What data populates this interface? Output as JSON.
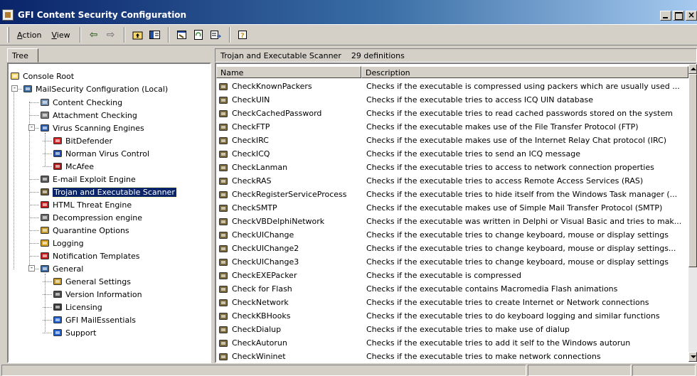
{
  "window": {
    "title": "GFI Content Security Configuration",
    "close_glyph": "×"
  },
  "menu": {
    "action_first": "A",
    "action_rest": "ction",
    "view_first": "V",
    "view_rest": "iew"
  },
  "toolbar_icons": [
    "back-arrow-icon",
    "forward-arrow-icon",
    "up-folder-icon",
    "show-tree-icon",
    "properties-icon",
    "refresh-icon",
    "export-list-icon",
    "help-icon"
  ],
  "toolbar_glyphs": {
    "back": "⇦",
    "forward": "⇨"
  },
  "left_tab": {
    "label": "Tree"
  },
  "tree": [
    {
      "label": "Console Root",
      "icon": "folder-icon",
      "color": "#f5d76e"
    },
    {
      "label": "MailSecurity Configuration (Local)",
      "icon": "mailsecurity-icon",
      "color": "#3a6ea5"
    },
    {
      "label": "Content Checking",
      "icon": "content-checking-icon",
      "color": "#6f8fb3"
    },
    {
      "label": "Attachment Checking",
      "icon": "paperclip-icon",
      "color": "#808080"
    },
    {
      "label": "Virus Scanning Engines",
      "icon": "virus-engines-icon",
      "color": "#2f5fb3"
    },
    {
      "label": "BitDefender",
      "icon": "bitdefender-icon",
      "color": "#d42020"
    },
    {
      "label": "Norman Virus Control",
      "icon": "norman-icon",
      "color": "#1f4fa8"
    },
    {
      "label": "McAfee",
      "icon": "mcafee-icon",
      "color": "#b01818"
    },
    {
      "label": "E-mail Exploit Engine",
      "icon": "exploit-engine-icon",
      "color": "#5a5a5a"
    },
    {
      "label": "Trojan and Executable Scanner",
      "icon": "trojan-scanner-icon",
      "color": "#6b5b2e"
    },
    {
      "label": "HTML Threat Engine",
      "icon": "html-threat-icon",
      "color": "#c21c1c"
    },
    {
      "label": "Decompression engine",
      "icon": "decompression-icon",
      "color": "#6b6b6b"
    },
    {
      "label": "Quarantine Options",
      "icon": "quarantine-icon",
      "color": "#c49a2a"
    },
    {
      "label": "Logging",
      "icon": "logging-icon",
      "color": "#d4a017"
    },
    {
      "label": "Notification Templates",
      "icon": "notification-icon",
      "color": "#c21c1c"
    },
    {
      "label": "General",
      "icon": "general-icon",
      "color": "#3a6ea5"
    },
    {
      "label": "General Settings",
      "icon": "settings-icon",
      "color": "#c49a2a"
    },
    {
      "label": "Version Information",
      "icon": "version-icon",
      "color": "#4a4a4a"
    },
    {
      "label": "Licensing",
      "icon": "licensing-icon",
      "color": "#3a3a3a"
    },
    {
      "label": "GFI MailEssentials",
      "icon": "ie-icon",
      "color": "#1f5fcf"
    },
    {
      "label": "Support",
      "icon": "ie-icon",
      "color": "#1f5fcf"
    }
  ],
  "right_header": {
    "title": "Trojan and Executable Scanner",
    "count": "29 definitions"
  },
  "columns": {
    "name": "Name",
    "description": "Description"
  },
  "definitions": [
    {
      "name": "CheckKnownPackers",
      "description": "Checks if the executable is compressed using packers which are usually used ..."
    },
    {
      "name": "CheckUIN",
      "description": "Checks if the executable tries to access ICQ UIN database"
    },
    {
      "name": "CheckCachedPassword",
      "description": "Checks if the executable tries to read cached passwords stored on the system"
    },
    {
      "name": "CheckFTP",
      "description": "Checks if the executable makes use of the File Transfer Protocol (FTP)"
    },
    {
      "name": "CheckIRC",
      "description": "Checks if the executable makes use of the Internet Relay Chat protocol (IRC)"
    },
    {
      "name": "CheckICQ",
      "description": "Checks if the executable tries to send an ICQ message"
    },
    {
      "name": "CheckLanman",
      "description": "Checks if the executable tries to access to network connection properties"
    },
    {
      "name": "CheckRAS",
      "description": "Checks if the executable tries to access Remote Access Services (RAS)"
    },
    {
      "name": "CheckRegisterServiceProcess",
      "description": "Checks if the executable tries to hide itself from the Windows Task manager (..."
    },
    {
      "name": "CheckSMTP",
      "description": "Checks if the executable makes use of Simple Mail Transfer Protocol (SMTP)"
    },
    {
      "name": "CheckVBDelphiNetwork",
      "description": "Checks if the executable was written in Delphi or Visual Basic and tries to mak..."
    },
    {
      "name": "CheckUIChange",
      "description": "Checks if the executable tries to change keyboard, mouse or display settings"
    },
    {
      "name": "CheckUIChange2",
      "description": "Checks if the executable tries to change keyboard, mouse or display settings..."
    },
    {
      "name": "CheckUIChange3",
      "description": "Checks if the executable tries to change keyboard, mouse or display settings"
    },
    {
      "name": "CheckEXEPacker",
      "description": "Checks if the executable is compressed"
    },
    {
      "name": "Check for Flash",
      "description": "Checks if the executable contains Macromedia Flash animations"
    },
    {
      "name": "CheckNetwork",
      "description": "Checks if the executable tries to create Internet or Network connections"
    },
    {
      "name": "CheckKBHooks",
      "description": "Checks if the executable tries to do keyboard logging and similar functions"
    },
    {
      "name": "CheckDialup",
      "description": "Checks if the executable tries to make use of dialup"
    },
    {
      "name": "CheckAutorun",
      "description": "Checks if the executable tries to add it self to the Windows autorun"
    },
    {
      "name": "CheckWininet",
      "description": "Checks if the executable tries to make network connections"
    }
  ],
  "colors": {
    "selection": "#0a246a",
    "title_gradient_start": "#0a246a",
    "face": "#d4d0c8"
  }
}
